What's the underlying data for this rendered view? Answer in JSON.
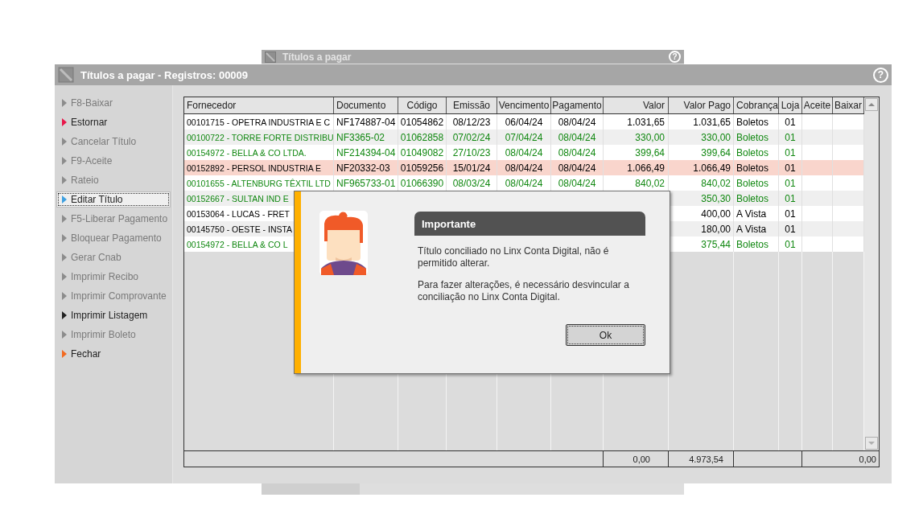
{
  "back_window": {
    "title": "Títulos a pagar",
    "help": "?"
  },
  "window": {
    "title": "Títulos a pagar - Registros: 00009",
    "help": "?"
  },
  "sidebar": {
    "items": [
      {
        "label": "F8-Baixar",
        "color": "#8c8c8c",
        "disabled": true,
        "selected": false
      },
      {
        "label": "Estornar",
        "color": "#e8174a",
        "disabled": false,
        "selected": false
      },
      {
        "label": "Cancelar Título",
        "color": "#8c8c8c",
        "disabled": true,
        "selected": false
      },
      {
        "label": "F9-Aceite",
        "color": "#8c8c8c",
        "disabled": true,
        "selected": false
      },
      {
        "label": "Rateio",
        "color": "#8c8c8c",
        "disabled": true,
        "selected": false
      },
      {
        "label": "Editar Título",
        "color": "#3fa0e0",
        "disabled": false,
        "selected": true
      },
      {
        "label": "F5-Liberar Pagamento",
        "color": "#8c8c8c",
        "disabled": true,
        "selected": false
      },
      {
        "label": "Bloquear Pagamento",
        "color": "#8c8c8c",
        "disabled": true,
        "selected": false
      },
      {
        "label": "Gerar Cnab",
        "color": "#8c8c8c",
        "disabled": true,
        "selected": false
      },
      {
        "label": "Imprimir Recibo",
        "color": "#8c8c8c",
        "disabled": true,
        "selected": false
      },
      {
        "label": "Imprimir Comprovante",
        "color": "#8c8c8c",
        "disabled": true,
        "selected": false
      },
      {
        "label": "Imprimir Listagem",
        "color": "#222222",
        "disabled": false,
        "selected": false
      },
      {
        "label": "Imprimir Boleto",
        "color": "#8c8c8c",
        "disabled": true,
        "selected": false
      },
      {
        "label": "Fechar",
        "color": "#f26a21",
        "disabled": false,
        "selected": false
      }
    ]
  },
  "table": {
    "columns": [
      "Fornecedor",
      "Documento",
      "Código",
      "Emissão",
      "Vencimento",
      "Pagamento",
      "Valor",
      "Valor Pago",
      "Cobrança",
      "Loja",
      "Aceite",
      "Baixar"
    ],
    "rows": [
      {
        "color": "#000000",
        "selected": false,
        "fornecedor": "00101715 - OPETRA INDUSTRIA E C",
        "documento": "NF174887-04",
        "codigo": "01054862",
        "emissao": "08/12/23",
        "vencimento": "06/04/24",
        "pagamento": "08/04/24",
        "valor": "1.031,65",
        "valor_pago": "1.031,65",
        "cobranca": "Boletos",
        "loja": "01"
      },
      {
        "color": "#118811",
        "selected": false,
        "fornecedor": "00100722 - TORRE FORTE DISTRIBU",
        "documento": "NF3365-02",
        "codigo": "01062858",
        "emissao": "07/02/24",
        "vencimento": "07/04/24",
        "pagamento": "08/04/24",
        "valor": "330,00",
        "valor_pago": "330,00",
        "cobranca": "Boletos",
        "loja": "01"
      },
      {
        "color": "#118811",
        "selected": false,
        "fornecedor": "00154972 - BELLA & CO LTDA.",
        "documento": "NF214394-04",
        "codigo": "01049082",
        "emissao": "27/10/23",
        "vencimento": "08/04/24",
        "pagamento": "08/04/24",
        "valor": "399,64",
        "valor_pago": "399,64",
        "cobranca": "Boletos",
        "loja": "01"
      },
      {
        "color": "#000000",
        "selected": true,
        "fornecedor": "00152892 - PERSOL INDUSTRIA E",
        "documento": "NF20332-03",
        "codigo": "01059256",
        "emissao": "15/01/24",
        "vencimento": "08/04/24",
        "pagamento": "08/04/24",
        "valor": "1.066,49",
        "valor_pago": "1.066,49",
        "cobranca": "Boletos",
        "loja": "01"
      },
      {
        "color": "#118811",
        "selected": false,
        "fornecedor": "00101655 - ALTENBURG TÊXTIL LTD",
        "documento": "NF965733-01",
        "codigo": "01066390",
        "emissao": "08/03/24",
        "vencimento": "08/04/24",
        "pagamento": "08/04/24",
        "valor": "840,02",
        "valor_pago": "840,02",
        "cobranca": "Boletos",
        "loja": "01"
      },
      {
        "color": "#118811",
        "selected": false,
        "fornecedor": "00152667 - SULTAN IND E",
        "valor_pago": "350,30",
        "cobranca": "Boletos",
        "loja": "01"
      },
      {
        "color": "#000000",
        "selected": false,
        "fornecedor": "00153064 - LUCAS - FRET",
        "valor_pago": "400,00",
        "cobranca": "A Vista",
        "loja": "01"
      },
      {
        "color": "#000000",
        "selected": false,
        "fornecedor": "00145750 - OESTE - INSTA",
        "valor_pago": "180,00",
        "cobranca": "A Vista",
        "loja": "01"
      },
      {
        "color": "#118811",
        "selected": false,
        "fornecedor": "00154972 - BELLA & CO L",
        "valor_pago": "375,44",
        "cobranca": "Boletos",
        "loja": "01"
      }
    ],
    "totals": {
      "valor": "0,00",
      "valor_pago": "4.973,54",
      "baixar": "0,00"
    }
  },
  "dialog": {
    "title": "Importante",
    "paragraphs": [
      "Título conciliado no Linx Conta Digital, não é permitido alterar.",
      "Para fazer alterações, é necessário desvincular a conciliação no Linx Conta Digital."
    ],
    "button": "Ok"
  }
}
